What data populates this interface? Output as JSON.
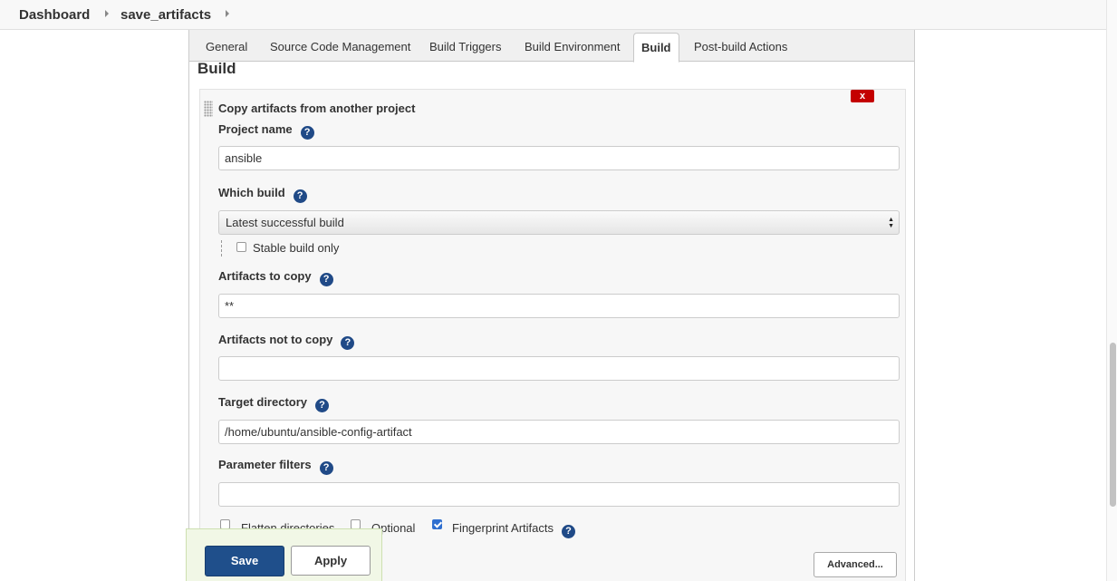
{
  "breadcrumb": {
    "dashboard": "Dashboard",
    "job": "save_artifacts"
  },
  "tabs": [
    {
      "label": "General"
    },
    {
      "label": "Source Code Management"
    },
    {
      "label": "Build Triggers"
    },
    {
      "label": "Build Environment"
    },
    {
      "label": "Build"
    },
    {
      "label": "Post-build Actions"
    }
  ],
  "section": {
    "title": "Build"
  },
  "step": {
    "title": "Copy artifacts from another project",
    "delete_label": "x",
    "help_glyph": "?",
    "project_name": {
      "label": "Project name",
      "value": "ansible"
    },
    "which_build": {
      "label": "Which build",
      "selected": "Latest successful build"
    },
    "stable_only": {
      "label": "Stable build only",
      "checked": false
    },
    "artifacts_to_copy": {
      "label": "Artifacts to copy",
      "value": "**"
    },
    "artifacts_not_to_copy": {
      "label": "Artifacts not to copy",
      "value": ""
    },
    "target_directory": {
      "label": "Target directory",
      "value": "/home/ubuntu/ansible-config-artifact"
    },
    "parameter_filters": {
      "label": "Parameter filters",
      "value": ""
    },
    "flatten": {
      "label": "Flatten directories",
      "checked": false
    },
    "optional": {
      "label": "Optional",
      "checked": false
    },
    "fingerprint": {
      "label": "Fingerprint Artifacts",
      "checked": true
    },
    "advanced_label": "Advanced..."
  },
  "actions": {
    "save": "Save",
    "apply": "Apply"
  },
  "colors": {
    "primary": "#1f4f8b",
    "danger": "#c40000",
    "help": "#204a87",
    "footer_bg": "#f1f7e6"
  }
}
